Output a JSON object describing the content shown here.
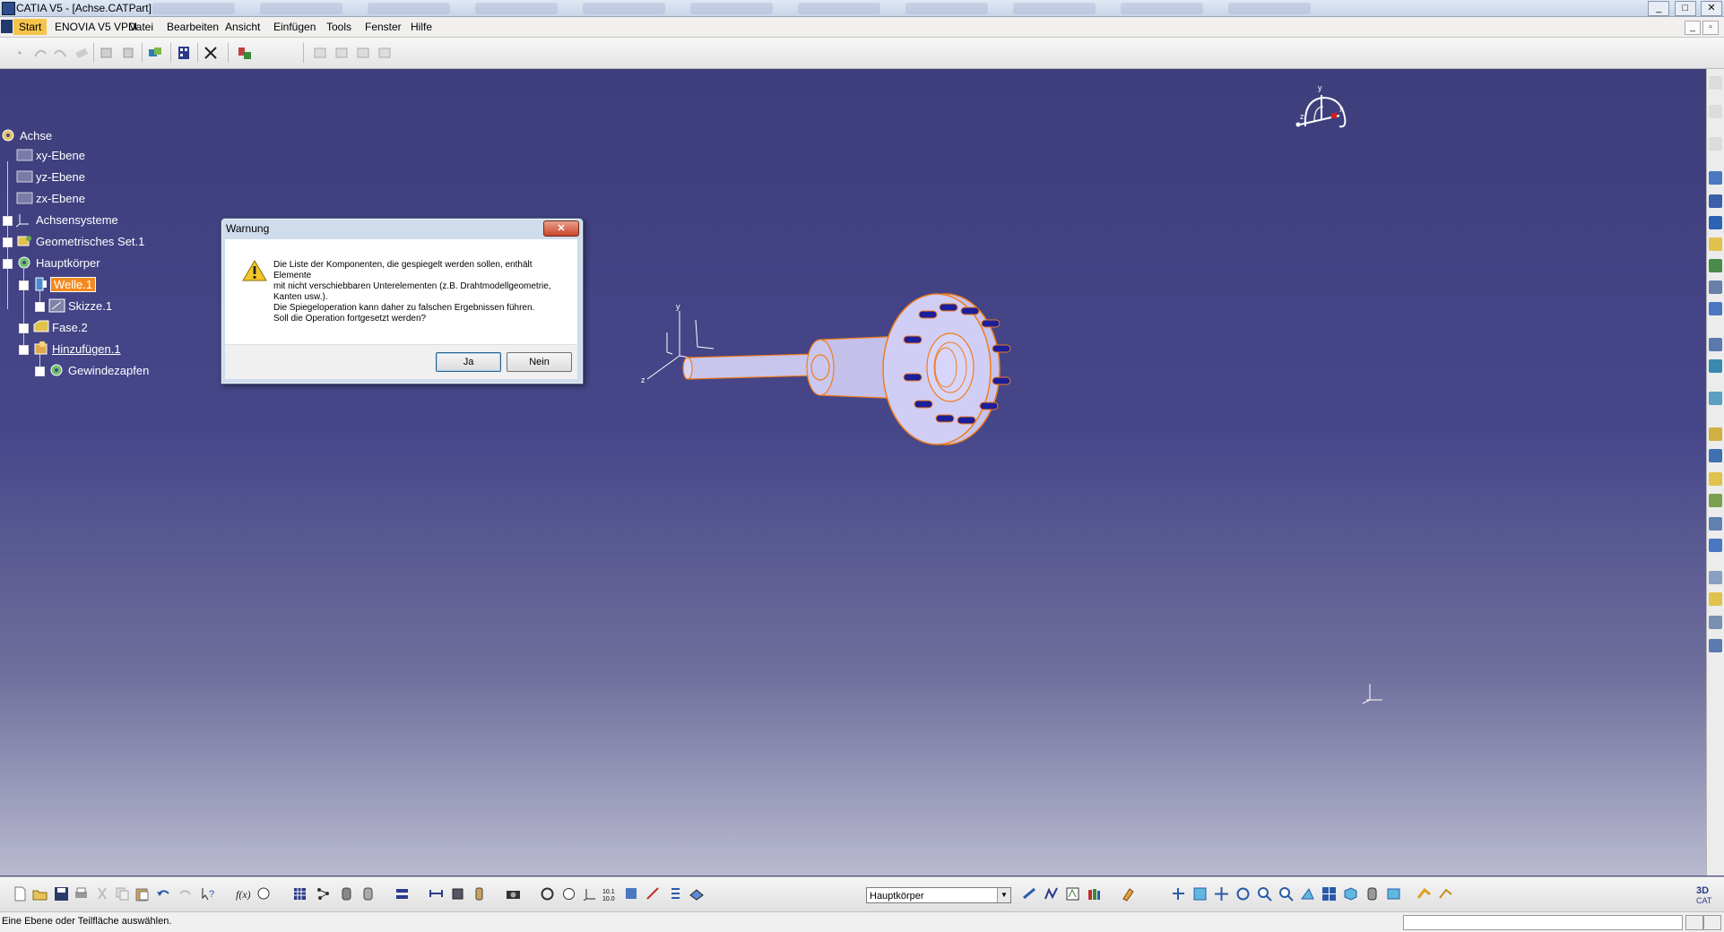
{
  "window": {
    "title": "CATIA V5 - [Achse.CATPart]",
    "controls": [
      "_",
      "□",
      "✕"
    ]
  },
  "menubar": {
    "items": [
      "Start",
      "ENOVIA V5 VPM",
      "Datei",
      "Bearbeiten",
      "Ansicht",
      "Einfügen",
      "Tools",
      "Fenster",
      "Hilfe"
    ]
  },
  "tree": {
    "root": "Achse",
    "nodes": [
      {
        "label": "xy-Ebene"
      },
      {
        "label": "yz-Ebene"
      },
      {
        "label": "zx-Ebene"
      },
      {
        "label": "Achsensysteme"
      },
      {
        "label": "Geometrisches Set.1"
      },
      {
        "label": "Hauptkörper"
      },
      {
        "label": "Welle.1"
      },
      {
        "label": "Skizze.1"
      },
      {
        "label": "Fase.2"
      },
      {
        "label": "Hinzufügen.1"
      },
      {
        "label": "Gewindezapfen"
      }
    ]
  },
  "dialog": {
    "title": "Warnung",
    "close": "✕",
    "message": [
      "Die Liste der Komponenten, die gespiegelt werden sollen, enthält",
      "Elemente",
      "mit nicht verschiebbaren Unterelementen (z.B. Drahtmodellgeometrie,",
      "Kanten usw.).",
      "Die Spiegeloperation kann daher zu falschen Ergebnissen führen.",
      "Soll die Operation fortgesetzt werden?"
    ],
    "yes_label": "Ja",
    "no_label": "Nein"
  },
  "axes": {
    "y": "y",
    "x": "x",
    "z": "z"
  },
  "bottom_toolbar": {
    "body_select": "Hauptkörper"
  },
  "status": {
    "text": "Eine Ebene oder Teilfläche auswählen."
  },
  "colors": {
    "viewport_top": "#3e3e7c",
    "selection": "#f28a1f",
    "part_fill": "#c9c6ee",
    "part_edge": "#f07c1a",
    "holes": "#1c1f9a"
  },
  "icons": {
    "warning": "warning-icon",
    "compass": "compass-icon"
  }
}
